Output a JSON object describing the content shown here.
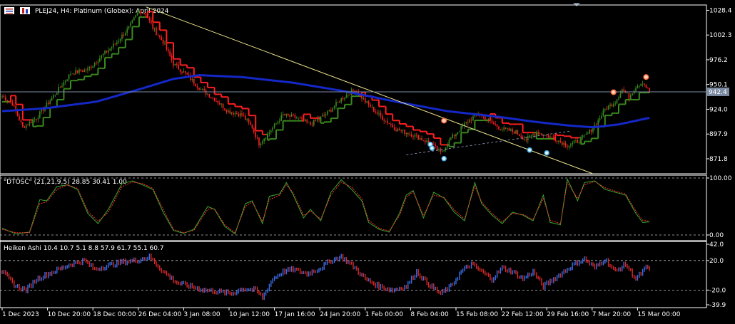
{
  "header": {
    "symbol_title": "PLEJ24, H4:  Platinum (Globex): April 2024"
  },
  "colors": {
    "background": "#000000",
    "bull": "#3a8a1e",
    "bear": "#ff1f1f",
    "ma": "#1428c8",
    "trendline": "#e8e08a",
    "current_price_line": "#7a8aa0",
    "osc_main": "#3aa62a",
    "osc_signal": "#ff3030",
    "ha_up": "#3d6ee8",
    "ha_down": "#d42a2a",
    "grid_dash": "#bdbdbd"
  },
  "chart_data": [
    {
      "type": "candlestick",
      "title": "PLEJ24, H4:  Platinum (Globex): April 2024",
      "ylim": [
        856,
        1034
      ],
      "y_ticks": [
        "1028.4",
        "1002.3",
        "976.2",
        "950.1",
        "924.0",
        "897.9",
        "871.8"
      ],
      "current_price": "942.4",
      "x_ticks": [
        "1 Dec 2023",
        "10 Dec 20:00",
        "18 Dec 00:00",
        "26 Dec 04:00",
        "3 Jan 08:00",
        "10 Jan 12:00",
        "17 Jan 16:00",
        "24 Jan 20:00",
        "1 Feb 00:00",
        "8 Feb 04:00",
        "15 Feb 08:00",
        "22 Feb 12:00",
        "29 Feb 16:00",
        "7 Mar 20:00",
        "15 Mar 00:00"
      ],
      "close_anchors": [
        [
          0,
          938
        ],
        [
          6,
          930
        ],
        [
          12,
          905
        ],
        [
          20,
          915
        ],
        [
          30,
          938
        ],
        [
          40,
          962
        ],
        [
          50,
          966
        ],
        [
          58,
          980
        ],
        [
          66,
          993
        ],
        [
          74,
          1010
        ],
        [
          80,
          1028
        ],
        [
          84,
          1024
        ],
        [
          88,
          1010
        ],
        [
          94,
          995
        ],
        [
          100,
          972
        ],
        [
          108,
          960
        ],
        [
          116,
          945
        ],
        [
          124,
          935
        ],
        [
          132,
          922
        ],
        [
          140,
          918
        ],
        [
          146,
          905
        ],
        [
          150,
          888
        ],
        [
          156,
          900
        ],
        [
          164,
          918
        ],
        [
          172,
          915
        ],
        [
          180,
          908
        ],
        [
          190,
          920
        ],
        [
          198,
          935
        ],
        [
          206,
          945
        ],
        [
          212,
          932
        ],
        [
          220,
          918
        ],
        [
          230,
          903
        ],
        [
          240,
          897
        ],
        [
          250,
          888
        ],
        [
          256,
          878
        ],
        [
          262,
          893
        ],
        [
          270,
          908
        ],
        [
          278,
          920
        ],
        [
          284,
          912
        ],
        [
          292,
          903
        ],
        [
          300,
          900
        ],
        [
          306,
          892
        ],
        [
          312,
          900
        ],
        [
          318,
          896
        ],
        [
          324,
          892
        ],
        [
          330,
          886
        ],
        [
          336,
          890
        ],
        [
          342,
          898
        ],
        [
          348,
          912
        ],
        [
          352,
          924
        ],
        [
          358,
          932
        ],
        [
          362,
          945
        ],
        [
          366,
          937
        ],
        [
          370,
          948
        ],
        [
          374,
          953
        ],
        [
          378,
          942
        ]
      ],
      "ma_points": [
        [
          0,
          922
        ],
        [
          25,
          925
        ],
        [
          55,
          932
        ],
        [
          80,
          945
        ],
        [
          100,
          956
        ],
        [
          115,
          960
        ],
        [
          140,
          958
        ],
        [
          170,
          952
        ],
        [
          200,
          943
        ],
        [
          230,
          932
        ],
        [
          260,
          922
        ],
        [
          290,
          916
        ],
        [
          310,
          911
        ],
        [
          330,
          907
        ],
        [
          345,
          905
        ],
        [
          360,
          908
        ],
        [
          378,
          915
        ]
      ],
      "trendline": [
        [
          84,
          1032
        ],
        [
          345,
          856
        ]
      ],
      "lower_line": [
        [
          236,
          876
        ],
        [
          332,
          901
        ]
      ],
      "markers": [
        {
          "i": 250,
          "p": 887,
          "kind": "down"
        },
        {
          "i": 251,
          "p": 883,
          "kind": "down"
        },
        {
          "i": 258,
          "p": 872,
          "kind": "down"
        },
        {
          "i": 308,
          "p": 881,
          "kind": "down"
        },
        {
          "i": 318,
          "p": 878,
          "kind": "down"
        },
        {
          "i": 258,
          "p": 912,
          "kind": "up"
        },
        {
          "i": 357,
          "p": 942,
          "kind": "up"
        },
        {
          "i": 376,
          "p": 958,
          "kind": "up"
        }
      ]
    },
    {
      "type": "line",
      "title": "\"DTOSC\" (21,21,9,5) 28.85 30.41 1.00",
      "ylim": [
        0,
        100
      ],
      "y_ticks": [
        "100.00",
        "0.00"
      ],
      "reference_levels": [
        100,
        0
      ],
      "series": [
        {
          "values": [
            [
              0,
              12
            ],
            [
              8,
              2
            ],
            [
              16,
              5
            ],
            [
              22,
              62
            ],
            [
              26,
              60
            ],
            [
              32,
              85
            ],
            [
              38,
              88
            ],
            [
              44,
              80
            ],
            [
              50,
              38
            ],
            [
              56,
              20
            ],
            [
              62,
              45
            ],
            [
              70,
              90
            ],
            [
              76,
              95
            ],
            [
              82,
              88
            ],
            [
              88,
              80
            ],
            [
              94,
              40
            ],
            [
              100,
              8
            ],
            [
              106,
              3
            ],
            [
              112,
              10
            ],
            [
              120,
              50
            ],
            [
              124,
              45
            ],
            [
              130,
              15
            ],
            [
              136,
              2
            ],
            [
              142,
              55
            ],
            [
              146,
              60
            ],
            [
              152,
              20
            ],
            [
              156,
              68
            ],
            [
              162,
              72
            ],
            [
              166,
              92
            ],
            [
              170,
              70
            ],
            [
              176,
              30
            ],
            [
              180,
              45
            ],
            [
              186,
              25
            ],
            [
              192,
              75
            ],
            [
              198,
              97
            ],
            [
              204,
              80
            ],
            [
              210,
              60
            ],
            [
              214,
              22
            ],
            [
              220,
              10
            ],
            [
              226,
              5
            ],
            [
              232,
              38
            ],
            [
              236,
              70
            ],
            [
              240,
              78
            ],
            [
              246,
              30
            ],
            [
              252,
              75
            ],
            [
              258,
              65
            ],
            [
              264,
              40
            ],
            [
              270,
              25
            ],
            [
              276,
              92
            ],
            [
              280,
              55
            ],
            [
              286,
              35
            ],
            [
              292,
              20
            ],
            [
              298,
              40
            ],
            [
              304,
              35
            ],
            [
              310,
              25
            ],
            [
              316,
              70
            ],
            [
              320,
              22
            ],
            [
              326,
              18
            ],
            [
              330,
              98
            ],
            [
              336,
              60
            ],
            [
              340,
              92
            ],
            [
              346,
              95
            ],
            [
              352,
              80
            ],
            [
              358,
              75
            ],
            [
              364,
              70
            ],
            [
              370,
              38
            ],
            [
              374,
              22
            ],
            [
              378,
              23
            ]
          ]
        },
        {
          "values": [
            [
              0,
              10
            ],
            [
              8,
              4
            ],
            [
              16,
              4
            ],
            [
              22,
              55
            ],
            [
              26,
              58
            ],
            [
              32,
              80
            ],
            [
              38,
              88
            ],
            [
              44,
              82
            ],
            [
              50,
              42
            ],
            [
              56,
              24
            ],
            [
              62,
              40
            ],
            [
              70,
              85
            ],
            [
              76,
              93
            ],
            [
              82,
              90
            ],
            [
              88,
              82
            ],
            [
              94,
              45
            ],
            [
              100,
              10
            ],
            [
              106,
              4
            ],
            [
              112,
              8
            ],
            [
              120,
              45
            ],
            [
              124,
              46
            ],
            [
              130,
              18
            ],
            [
              136,
              4
            ],
            [
              142,
              50
            ],
            [
              146,
              58
            ],
            [
              152,
              24
            ],
            [
              156,
              62
            ],
            [
              162,
              70
            ],
            [
              166,
              88
            ],
            [
              170,
              74
            ],
            [
              176,
              34
            ],
            [
              180,
              42
            ],
            [
              186,
              28
            ],
            [
              192,
              70
            ],
            [
              198,
              93
            ],
            [
              204,
              84
            ],
            [
              210,
              64
            ],
            [
              214,
              26
            ],
            [
              220,
              12
            ],
            [
              226,
              7
            ],
            [
              232,
              34
            ],
            [
              236,
              66
            ],
            [
              240,
              76
            ],
            [
              246,
              34
            ],
            [
              252,
              70
            ],
            [
              258,
              66
            ],
            [
              264,
              44
            ],
            [
              270,
              28
            ],
            [
              276,
              86
            ],
            [
              280,
              58
            ],
            [
              286,
              38
            ],
            [
              292,
              23
            ],
            [
              298,
              38
            ],
            [
              304,
              36
            ],
            [
              310,
              27
            ],
            [
              316,
              64
            ],
            [
              320,
              26
            ],
            [
              326,
              20
            ],
            [
              330,
              92
            ],
            [
              336,
              64
            ],
            [
              340,
              88
            ],
            [
              346,
              94
            ],
            [
              352,
              83
            ],
            [
              358,
              77
            ],
            [
              364,
              72
            ],
            [
              370,
              42
            ],
            [
              374,
              26
            ],
            [
              378,
              24
            ]
          ]
        }
      ]
    },
    {
      "type": "bar",
      "title": "Heiken Ashi 10.4 10.7 5.1 8.8 57.9 61.7 55.1 60.7",
      "ylim": [
        -39.9,
        42.0
      ],
      "y_ticks": [
        "42.0",
        "20.0",
        "-20.0",
        "-39.9"
      ],
      "reference_levels": [
        20,
        -20
      ],
      "series": [
        {
          "values": [
            [
              0,
              5
            ],
            [
              8,
              -15
            ],
            [
              14,
              -20
            ],
            [
              20,
              -5
            ],
            [
              30,
              5
            ],
            [
              40,
              15
            ],
            [
              48,
              20
            ],
            [
              54,
              8
            ],
            [
              60,
              12
            ],
            [
              70,
              18
            ],
            [
              78,
              20
            ],
            [
              86,
              25
            ],
            [
              94,
              5
            ],
            [
              102,
              -10
            ],
            [
              110,
              -15
            ],
            [
              118,
              -20
            ],
            [
              126,
              -22
            ],
            [
              134,
              -25
            ],
            [
              140,
              -18
            ],
            [
              148,
              -20
            ],
            [
              152,
              -30
            ],
            [
              158,
              -5
            ],
            [
              164,
              5
            ],
            [
              170,
              8
            ],
            [
              178,
              2
            ],
            [
              186,
              10
            ],
            [
              192,
              20
            ],
            [
              198,
              25
            ],
            [
              206,
              10
            ],
            [
              212,
              -5
            ],
            [
              220,
              -15
            ],
            [
              228,
              -20
            ],
            [
              236,
              -15
            ],
            [
              242,
              5
            ],
            [
              248,
              -10
            ],
            [
              256,
              -25
            ],
            [
              262,
              -15
            ],
            [
              268,
              5
            ],
            [
              274,
              15
            ],
            [
              280,
              5
            ],
            [
              286,
              -5
            ],
            [
              292,
              10
            ],
            [
              298,
              5
            ],
            [
              304,
              -5
            ],
            [
              310,
              5
            ],
            [
              316,
              -15
            ],
            [
              322,
              -5
            ],
            [
              328,
              5
            ],
            [
              334,
              15
            ],
            [
              340,
              22
            ],
            [
              346,
              10
            ],
            [
              352,
              22
            ],
            [
              358,
              5
            ],
            [
              364,
              15
            ],
            [
              370,
              -5
            ],
            [
              376,
              10
            ],
            [
              378,
              8
            ]
          ]
        }
      ]
    }
  ]
}
